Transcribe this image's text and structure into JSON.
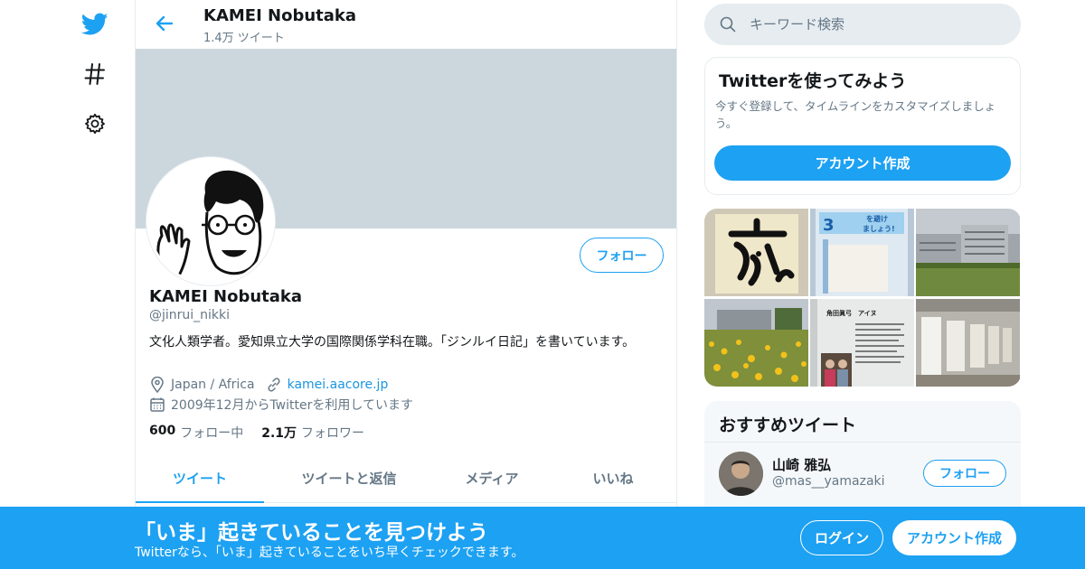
{
  "nav": {
    "icons": [
      "twitter-logo-icon",
      "hashtag-icon",
      "gear-icon"
    ]
  },
  "header": {
    "name": "KAMEI Nobutaka",
    "tweet_count": "1.4万 ツイート"
  },
  "profile": {
    "follow_label": "フォロー",
    "name": "KAMEI Nobutaka",
    "handle": "@jinrui_nikki",
    "bio": "文化人類学者。愛知県立大学の国際関係学科在職。「ジンルイ日記」を書いています。",
    "location": "Japan / Africa",
    "website": "kamei.aacore.jp",
    "joined": "2009年12月からTwitterを利用しています",
    "following_count": "600",
    "following_label": "フォロー中",
    "followers_count": "2.1万",
    "followers_label": "フォロワー"
  },
  "tabs": [
    {
      "label": "ツイート",
      "active": true
    },
    {
      "label": "ツイートと返信",
      "active": false
    },
    {
      "label": "メディア",
      "active": false
    },
    {
      "label": "いいね",
      "active": false
    }
  ],
  "search": {
    "placeholder": "キーワード検索"
  },
  "signup_card": {
    "title": "Twitterを使ってみよう",
    "description": "今すぐ登録して、タイムラインをカスタマイズしましょう。",
    "button": "アカウント作成"
  },
  "media_tile_text": {
    "sign_3": "3",
    "sign_line1": "を避け",
    "sign_line2": "ましょう!",
    "poster_title": "角田眞弓　アイヌ"
  },
  "recommended": {
    "title": "おすすめツイート",
    "name": "山崎 雅弘",
    "handle": "@mas__yamazaki",
    "follow_label": "フォロー"
  },
  "bottom_bar": {
    "title": "「いま」起きていることを見つけよう",
    "subtitle": "Twitterなら、「いま」起きていることをいち早くチェックできます。",
    "login": "ログイン",
    "signup": "アカウント作成"
  },
  "colors": {
    "accent": "#1da1f2",
    "banner": "#ccd6dd",
    "muted_text": "#657786",
    "border": "#e6ecf0"
  }
}
